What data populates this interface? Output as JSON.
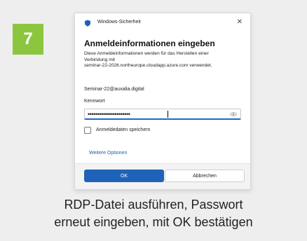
{
  "step": {
    "number": "7",
    "color": "#8cc63f"
  },
  "dialog": {
    "window_title": "Windows-Sicherheit",
    "close_icon": "close-icon",
    "heading": "Anmeldeinformationen eingeben",
    "description_lines": [
      "Diese Anmeldeinformationen werden für das Herstellen einer",
      "Verbindung mit",
      "seminar-22-2026.northeurope.cloudapp.azure.com verwendet."
    ],
    "username": "Seminar-22@auxalia.digital",
    "password_label": "Kennwort",
    "password_value": "••••••••••••••••••••••",
    "reveal_icon": "eye-icon",
    "remember_label": "Anmeldedaten speichern",
    "remember_checked": false,
    "more_options_link": "Weitere Optionen",
    "ok_label": "OK",
    "cancel_label": "Abbrechen",
    "accent_color": "#1f63b8"
  },
  "caption_lines": [
    "RDP-Datei ausführen, Passwort",
    "erneut eingeben, mit OK bestätigen"
  ]
}
